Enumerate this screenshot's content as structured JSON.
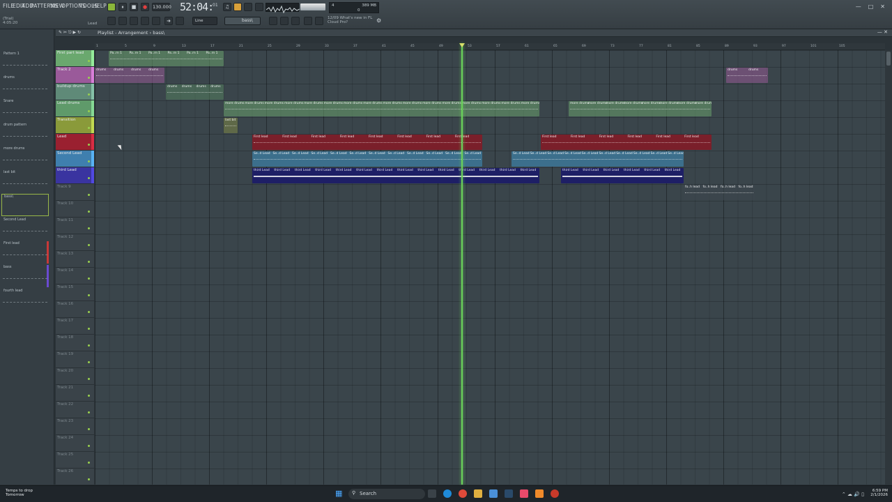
{
  "menu": {
    "items": [
      "FILE",
      "EDIT",
      "ADD",
      "PATTERNS",
      "VIEW",
      "OPTIONS",
      "TOOLS",
      "HELP"
    ]
  },
  "transport": {
    "bpm": "130.000",
    "time": "52:04:",
    "time_sub": "01",
    "mode_label": "Line"
  },
  "hint": {
    "line1": "(Trial)",
    "line2": "4:05:20",
    "lead_label": "Lead"
  },
  "news": {
    "line1": "12/09  What's new in FL",
    "line2": "Cloud Pro?"
  },
  "cpu": {
    "val1": "4",
    "val2": "389 MB",
    "val3": "0"
  },
  "pattern_selector": "bass\\",
  "playlist": {
    "title": "Playlist - Arrangement › bass\\"
  },
  "ruler": {
    "bars": [
      "1",
      "5",
      "9",
      "13",
      "17",
      "21",
      "25",
      "29",
      "33",
      "37",
      "41",
      "45",
      "49",
      "53",
      "57",
      "61",
      "65",
      "69",
      "73",
      "77",
      "81",
      "85",
      "89",
      "93",
      "97",
      "101",
      "105"
    ]
  },
  "patterns": [
    {
      "name": "Pattern 1"
    },
    {
      "name": "drums"
    },
    {
      "name": "Snare"
    },
    {
      "name": "drum pattern"
    },
    {
      "name": "more drums"
    },
    {
      "name": "last bit"
    },
    {
      "name": "bass\\"
    },
    {
      "name": "Second Lead"
    },
    {
      "name": "First lead"
    },
    {
      "name": "bass"
    },
    {
      "name": "fourth lead"
    }
  ],
  "tracks": [
    {
      "name": "First part lead",
      "color": "#6aa86e"
    },
    {
      "name": "Track 2",
      "color": "#9a5a9a"
    },
    {
      "name": "buildup drums",
      "color": "#5f8a78"
    },
    {
      "name": "Lead drums",
      "color": "#5f9a6a"
    },
    {
      "name": "Transition",
      "color": "#8a9a3a"
    },
    {
      "name": "Lead",
      "color": "#9a2030"
    },
    {
      "name": "Second Lead",
      "color": "#3f7fae"
    },
    {
      "name": "third Lead",
      "color": "#3a34a0"
    },
    {
      "name": "Track 9",
      "color": "#3a4349"
    },
    {
      "name": "Track 10",
      "color": "#3a4349"
    },
    {
      "name": "Track 11",
      "color": "#3a4349"
    },
    {
      "name": "Track 12",
      "color": "#3a4349"
    },
    {
      "name": "Track 13",
      "color": "#3a4349"
    },
    {
      "name": "Track 14",
      "color": "#3a4349"
    },
    {
      "name": "Track 15",
      "color": "#3a4349"
    },
    {
      "name": "Track 16",
      "color": "#3a4349"
    },
    {
      "name": "Track 17",
      "color": "#3a4349"
    },
    {
      "name": "Track 18",
      "color": "#3a4349"
    },
    {
      "name": "Track 19",
      "color": "#3a4349"
    },
    {
      "name": "Track 20",
      "color": "#3a4349"
    },
    {
      "name": "Track 21",
      "color": "#3a4349"
    },
    {
      "name": "Track 22",
      "color": "#3a4349"
    },
    {
      "name": "Track 23",
      "color": "#3a4349"
    },
    {
      "name": "Track 24",
      "color": "#3a4349"
    },
    {
      "name": "Track 25",
      "color": "#3a4349"
    },
    {
      "name": "Track 26",
      "color": "#3a4349"
    }
  ],
  "clips": {
    "first_lead": "First lead",
    "second_lead": "Se..d Lead",
    "third_lead": "third Lead",
    "lead_drums": "more drums",
    "bass": "bass",
    "drums": "drums",
    "pattern": "Pa..rn 1",
    "transition": "last bit",
    "fourth": "fo..h lead"
  },
  "taskbar": {
    "weather_line1": "Temps to drop",
    "weather_line2": "Tomorrow",
    "search_label": "Search",
    "clock_time": "6:59 PM",
    "clock_date": "2/1/2026"
  }
}
